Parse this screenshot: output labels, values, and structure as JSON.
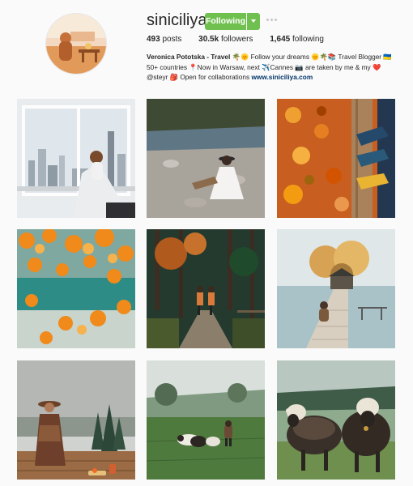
{
  "profile": {
    "username": "siniciliya",
    "follow_label": "Following",
    "posts": "493",
    "posts_label": "posts",
    "followers": "30.5k",
    "followers_label": "followers",
    "following": "1,645",
    "following_label": "following"
  },
  "bio": {
    "name": "Veronica Pototska - Travel",
    "line1": "🌴🌞 Follow your dreams 🌞🌴📚 Travel Blogger 🇺🇦",
    "line2": "50+ countries 📍Now in Warsaw, next ✈️Cannes 📷 are taken by me & my ❤️",
    "line3_handle": "@steyr",
    "line3_text": "🎒 Open for collaborations",
    "link": "www.siniciliya.com"
  },
  "colors": {
    "follow_green": "#70c050",
    "link_blue": "#003569",
    "background": "#fafafa"
  },
  "posts": [
    {
      "icon": "photo-window-city-view"
    },
    {
      "icon": "photo-river-sitting"
    },
    {
      "icon": "photo-autumn-leaves-feet"
    },
    {
      "icon": "photo-orange-foliage-lake"
    },
    {
      "icon": "photo-forest-walk-couple"
    },
    {
      "icon": "photo-lake-pier-cabin"
    },
    {
      "icon": "photo-hat-woman-hills"
    },
    {
      "icon": "photo-sheep-meadow"
    },
    {
      "icon": "photo-black-sheep-closeup"
    }
  ]
}
